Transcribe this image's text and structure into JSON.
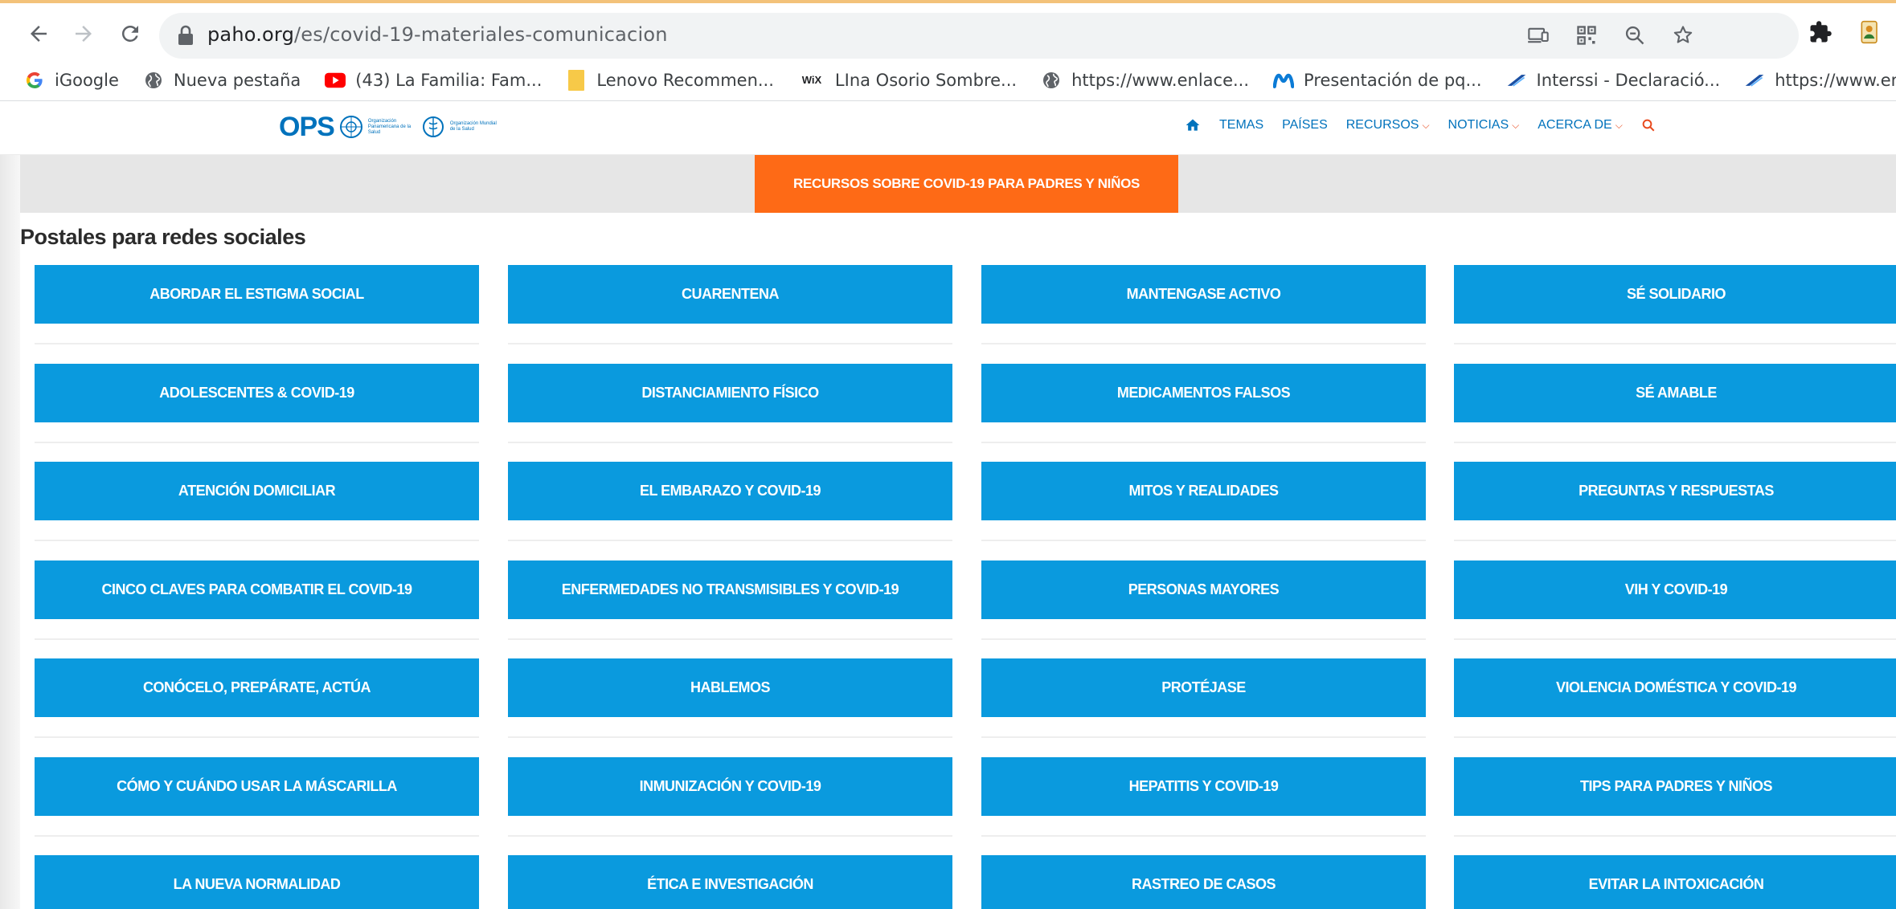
{
  "browser": {
    "url_host": "paho.org",
    "url_path": "/es/covid-19-materiales-comunicacion",
    "bookmarks": [
      {
        "label": "iGoogle",
        "icon": "google-icon"
      },
      {
        "label": "Nueva pestaña",
        "icon": "globe-icon"
      },
      {
        "label": "(43) La Familia: Fam...",
        "icon": "youtube-icon"
      },
      {
        "label": "Lenovo Recommen...",
        "icon": "bookmark-folder-icon"
      },
      {
        "label": "LIna Osorio Sombre...",
        "icon": "wix-icon"
      },
      {
        "label": "https://www.enlace...",
        "icon": "globe-icon"
      },
      {
        "label": "Presentación de pq...",
        "icon": "movistar-icon"
      },
      {
        "label": "Interssi - Declaració...",
        "icon": "interssi-icon"
      },
      {
        "label": "https://www.enlace...",
        "icon": "interssi-icon"
      }
    ]
  },
  "site": {
    "logo_text": "OPS",
    "logo_org_1": "Organización Panamericana de la Salud",
    "logo_org_2": "Organización Mundial de la Salud",
    "nav": {
      "temas": "TEMAS",
      "paises": "PAÍSES",
      "recursos": "RECURSOS",
      "noticias": "NOTICIAS",
      "acerca": "ACERCA DE"
    },
    "accent_color": "#0072bc",
    "chevron_color": "#e8491d"
  },
  "banner": {
    "label": "RECURSOS SOBRE COVID-19 PARA PADRES Y NIÑOS",
    "color": "#fe6a16"
  },
  "section": {
    "title": "Postales para redes sociales",
    "card_color": "#0a9ade",
    "cards": [
      [
        "ABORDAR EL ESTIGMA SOCIAL",
        "CUARENTENA",
        "MANTENGASE ACTIVO",
        "SÉ SOLIDARIO"
      ],
      [
        "ADOLESCENTES & COVID-19",
        "DISTANCIAMIENTO FÍSICO",
        "MEDICAMENTOS FALSOS",
        "SÉ AMABLE"
      ],
      [
        "ATENCIÓN DOMICILIAR",
        "EL EMBARAZO Y COVID-19",
        "MITOS Y REALIDADES",
        "PREGUNTAS Y RESPUESTAS"
      ],
      [
        "CINCO CLAVES PARA COMBATIR EL COVID-19",
        "ENFERMEDADES NO TRANSMISIBLES Y COVID-19",
        "PERSONAS MAYORES",
        "VIH Y COVID-19"
      ],
      [
        "CONÓCELO, PREPÁRATE, ACTÚA",
        "HABLEMOS",
        "PROTÉJASE",
        "VIOLENCIA DOMÉSTICA Y COVID-19"
      ],
      [
        "CÓMO Y CUÁNDO USAR LA MÁSCARILLA",
        "INMUNIZACIÓN Y COVID-19",
        "HEPATITIS Y COVID-19",
        "TIPS PARA PADRES Y NIÑOS"
      ],
      [
        "LA NUEVA NORMALIDAD",
        "ÉTICA E INVESTIGACIÓN",
        "RASTREO DE CASOS",
        "EVITAR LA INTOXICACIÓN"
      ]
    ]
  }
}
